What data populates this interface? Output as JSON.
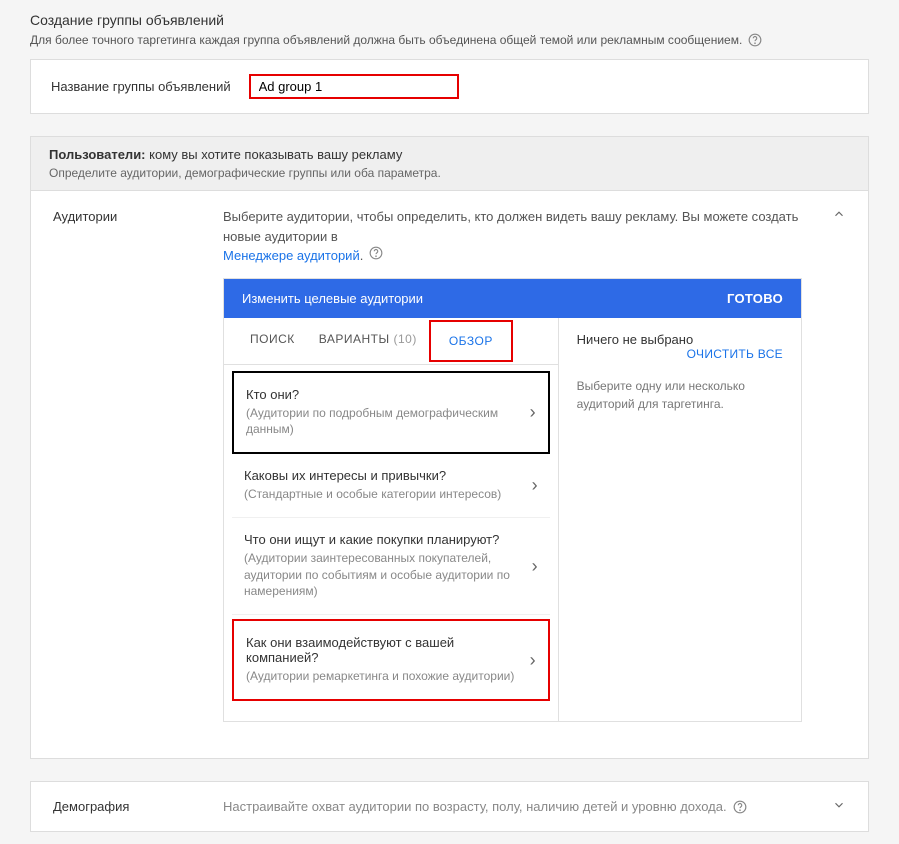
{
  "page": {
    "title": "Создание группы объявлений",
    "subtitle": "Для более точного таргетинга каждая группа объявлений должна быть объединена общей темой или рекламным сообщением."
  },
  "adgroup": {
    "label": "Название группы объявлений",
    "value": "Ad group 1"
  },
  "users": {
    "prefix": "Пользователи:",
    "rest": " кому вы хотите показывать вашу рекламу",
    "sub": "Определите аудитории, демографические группы или оба параметра."
  },
  "audiences": {
    "section_label": "Аудитории",
    "desc_part1": "Выберите аудитории, чтобы определить, кто должен видеть вашу рекламу.  Вы можете создать новые аудитории в ",
    "desc_link": "Менеджере аудиторий",
    "panel_title": "Изменить целевые аудитории",
    "done": "ГОТОВО",
    "tabs": {
      "search": "ПОИСК",
      "ideas": "ВАРИАНТЫ",
      "ideas_count": "(10)",
      "browse": "ОБЗОР"
    },
    "categories": [
      {
        "title": "Кто они?",
        "sub": "(Аудитории по подробным демографическим данным)"
      },
      {
        "title": "Каковы их интересы и привычки?",
        "sub": "(Стандартные и особые категории интересов)"
      },
      {
        "title": "Что они ищут и какие покупки планируют?",
        "sub": "(Аудитории заинтересованных покупателей, аудитории по событиям и особые аудитории по намерениям)"
      },
      {
        "title": "Как они взаимодействуют с вашей компанией?",
        "sub": "(Аудитории ремаркетинга и похожие аудитории)"
      }
    ],
    "none_selected": "Ничего не выбрано",
    "clear_all": "ОЧИСТИТЬ ВСЕ",
    "select_prompt": "Выберите одну или несколько аудиторий для таргетинга."
  },
  "demography": {
    "label": "Демография",
    "desc": "Настраивайте охват аудитории по возрасту, полу, наличию детей и уровню дохода."
  }
}
